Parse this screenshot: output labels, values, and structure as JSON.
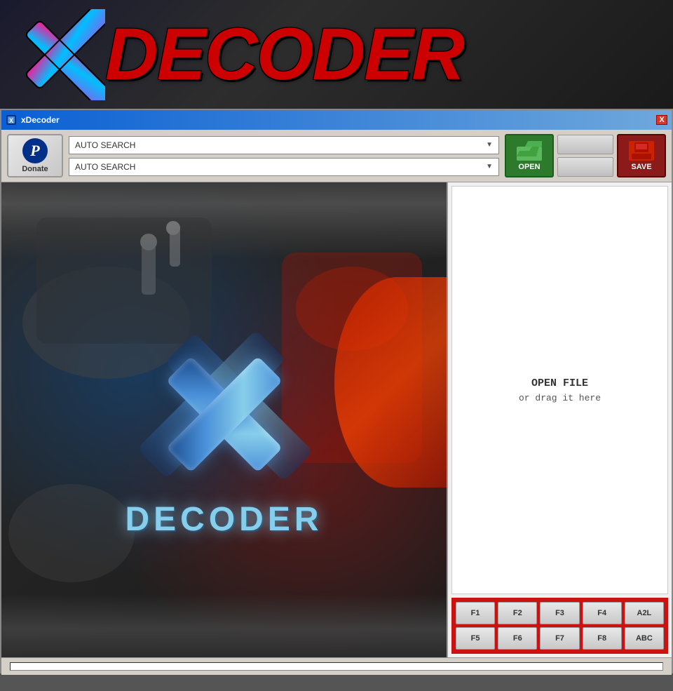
{
  "banner": {
    "title": "DECODER",
    "app_name": "xDecoder"
  },
  "titlebar": {
    "title": "xDecoder",
    "close_label": "X"
  },
  "toolbar": {
    "donate_label": "Donate",
    "paypal_letter": "P",
    "dropdown1_value": "AUTO SEARCH",
    "dropdown2_value": "AUTO SEARCH",
    "open_label": "OPEN",
    "save_label": "SAVE"
  },
  "drop_zone": {
    "line1": "OPEN FILE",
    "line2": "or drag it here"
  },
  "fn_buttons": [
    {
      "label": "F1"
    },
    {
      "label": "F2"
    },
    {
      "label": "F3"
    },
    {
      "label": "F4"
    },
    {
      "label": "A2L"
    },
    {
      "label": "F5"
    },
    {
      "label": "F6"
    },
    {
      "label": "F7"
    },
    {
      "label": "F8"
    },
    {
      "label": "ABC"
    }
  ],
  "splash": {
    "decoder_text": "DECODER"
  }
}
